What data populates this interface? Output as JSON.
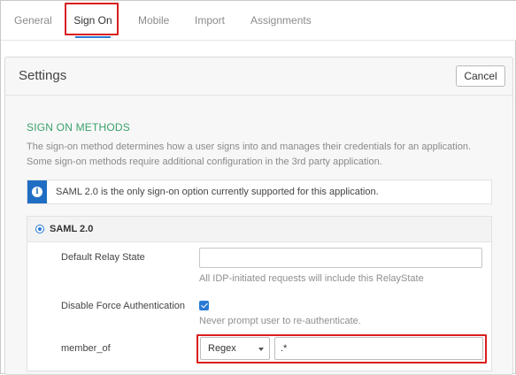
{
  "tabs": [
    {
      "label": "General"
    },
    {
      "label": "Sign On"
    },
    {
      "label": "Mobile"
    },
    {
      "label": "Import"
    },
    {
      "label": "Assignments"
    }
  ],
  "settings": {
    "title": "Settings",
    "cancel_label": "Cancel",
    "section_heading": "SIGN ON METHODS",
    "section_description": "The sign-on method determines how a user signs into and manages their credentials for an application. Some sign-on methods require additional configuration in the 3rd party application.",
    "info_message": "SAML 2.0 is the only sign-on option currently supported for this application.",
    "saml": {
      "label": "SAML 2.0",
      "default_relay_state": {
        "label": "Default Relay State",
        "value": "",
        "hint": "All IDP-initiated requests will include this RelayState"
      },
      "disable_force_auth": {
        "label": "Disable Force Authentication",
        "checked": true,
        "hint": "Never prompt user to re-authenticate."
      },
      "member_of": {
        "label": "member_of",
        "filter_type": "Regex",
        "filter_value": ".*"
      }
    }
  },
  "colors": {
    "accent": "#2a7ad5",
    "highlight": "#d81e1e",
    "section_heading": "#3aa16a",
    "info_strip": "#1f6ec4"
  },
  "icons": [
    "info-icon",
    "radio-selected-icon",
    "checkbox-checked-icon",
    "chevron-down-icon"
  ]
}
